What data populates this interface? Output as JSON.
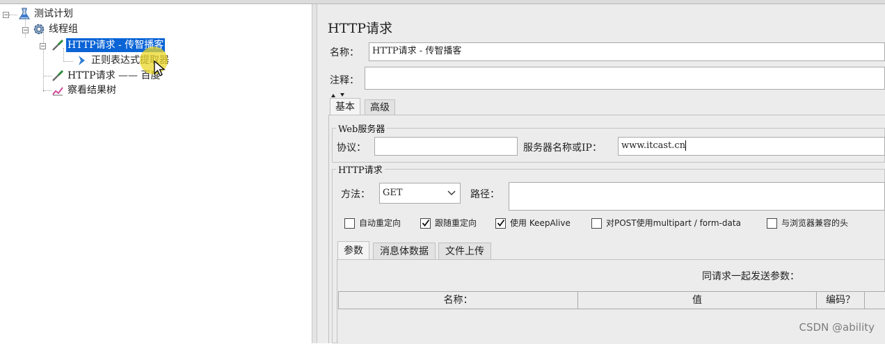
{
  "tree": {
    "test_plan": "测试计划",
    "thread_group": "线程组",
    "http_request_1": "HTTP请求 - 传智播客",
    "regex_extractor": "正则表达式提取器",
    "http_request_2": "HTTP请求 —— 百度",
    "result_tree": "察看结果树"
  },
  "panel": {
    "title": "HTTP请求",
    "name_label": "名称：",
    "name_value": "HTTP请求 - 传智播客",
    "comment_label": "注释：",
    "comment_value": "",
    "tabs": [
      "基本",
      "高级"
    ],
    "web_server": {
      "group_title": "Web服务器",
      "protocol_label": "协议：",
      "protocol_value": "",
      "server_label": "服务器名称或IP：",
      "server_value": "www.itcast.cn"
    },
    "http_request": {
      "group_title": "HTTP请求",
      "method_label": "方法：",
      "method_value": "GET",
      "path_label": "路径：",
      "path_value": ""
    },
    "options": [
      {
        "label": "自动重定向",
        "checked": false
      },
      {
        "label": "跟随重定向",
        "checked": true
      },
      {
        "label": "使用 KeepAlive",
        "checked": true
      },
      {
        "label": "对POST使用multipart / form-data",
        "checked": false
      },
      {
        "label": "与浏览器兼容的头",
        "checked": false
      }
    ],
    "param_tabs": [
      "参数",
      "消息体数据",
      "文件上传"
    ],
    "params_caption": "同请求一起发送参数：",
    "table_headers": [
      "名称：",
      "值",
      "编码？"
    ]
  },
  "watermark": "CSDN @ability"
}
